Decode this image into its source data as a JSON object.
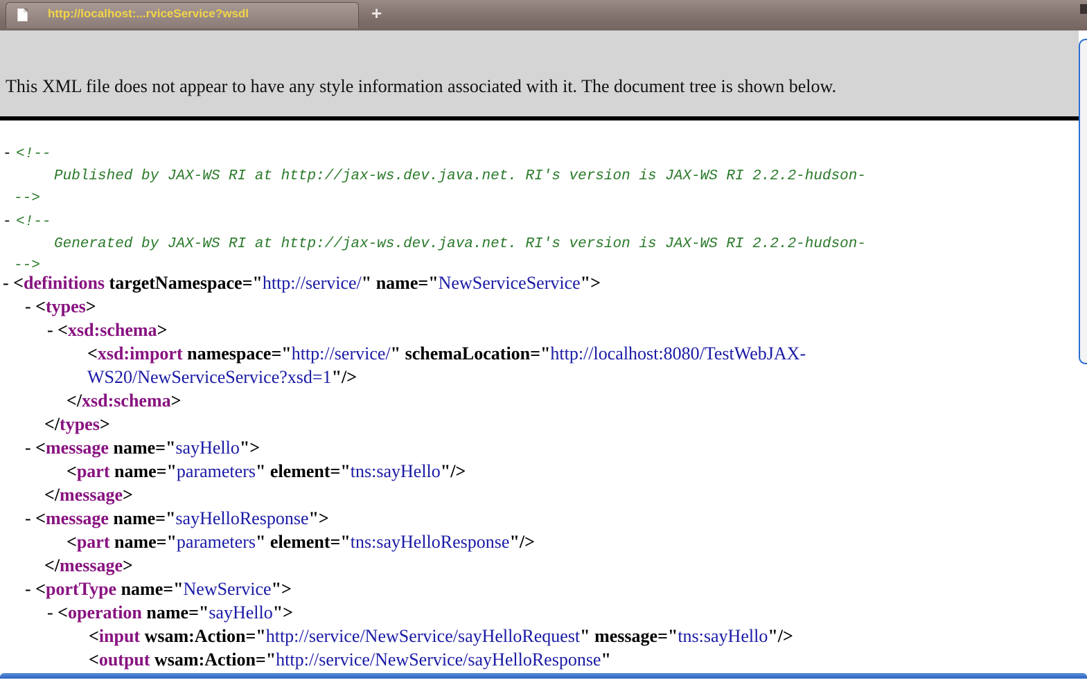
{
  "browser": {
    "tab_title": "http://localhost:...rviceService?wsdl",
    "new_tab_label": "+"
  },
  "info_message": "This XML file does not appear to have any style information associated with it. The document tree is shown below.",
  "tree": {
    "toggle": "-",
    "comment_open": "<!--",
    "comment_close": "-->",
    "comment1": "Published by JAX-WS RI at http://jax-ws.dev.java.net. RI's version is JAX-WS RI 2.2.2-hudson-",
    "comment2": "Generated by JAX-WS RI at http://jax-ws.dev.java.net. RI's version is JAX-WS RI 2.2.2-hudson-",
    "def_tag": "definitions",
    "def_attr1": "targetNamespace",
    "def_val1": "http://service/",
    "def_attr2": "name",
    "def_val2": "NewServiceService",
    "types_tag": "types",
    "schema_tag": "xsd:schema",
    "import_tag": "xsd:import",
    "import_attr1": "namespace",
    "import_val1": "http://service/",
    "import_attr2": "schemaLocation",
    "import_val2a": "http://localhost:8080/TestWebJAX-",
    "import_val2b": "WS20/NewServiceService?xsd=1",
    "message_tag": "message",
    "name_attr": "name",
    "msg1_name": "sayHello",
    "part_tag": "part",
    "part_attr1": "name",
    "part_val1": "parameters",
    "part_attr2": "element",
    "part1_val2": "tns:sayHello",
    "msg2_name": "sayHelloResponse",
    "part2_val2": "tns:sayHelloResponse",
    "porttype_tag": "portType",
    "porttype_name": "NewService",
    "operation_tag": "operation",
    "operation_name": "sayHello",
    "input_tag": "input",
    "action_attr": "wsam:Action",
    "input_action": "http://service/NewService/sayHelloRequest",
    "message_attr": "message",
    "input_message": "tns:sayHello",
    "output_tag": "output",
    "output_action": "http://service/NewService/sayHelloResponse"
  }
}
